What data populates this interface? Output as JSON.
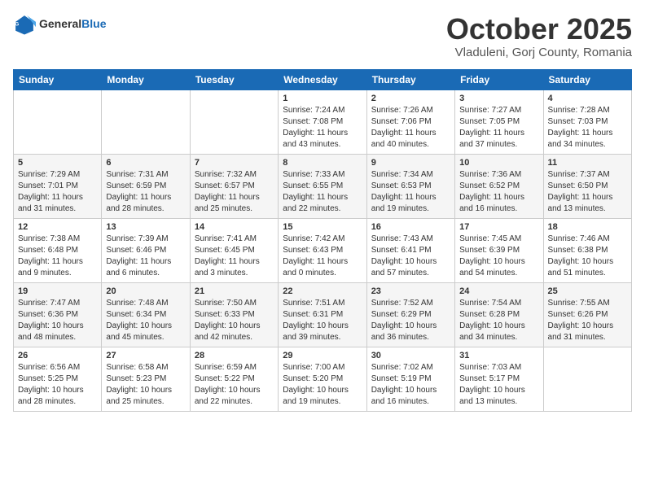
{
  "header": {
    "logo_general": "General",
    "logo_blue": "Blue",
    "month": "October 2025",
    "location": "Vladuleni, Gorj County, Romania"
  },
  "days_of_week": [
    "Sunday",
    "Monday",
    "Tuesday",
    "Wednesday",
    "Thursday",
    "Friday",
    "Saturday"
  ],
  "weeks": [
    [
      {
        "day": "",
        "sunrise": "",
        "sunset": "",
        "daylight": ""
      },
      {
        "day": "",
        "sunrise": "",
        "sunset": "",
        "daylight": ""
      },
      {
        "day": "",
        "sunrise": "",
        "sunset": "",
        "daylight": ""
      },
      {
        "day": "1",
        "sunrise": "Sunrise: 7:24 AM",
        "sunset": "Sunset: 7:08 PM",
        "daylight": "Daylight: 11 hours and 43 minutes."
      },
      {
        "day": "2",
        "sunrise": "Sunrise: 7:26 AM",
        "sunset": "Sunset: 7:06 PM",
        "daylight": "Daylight: 11 hours and 40 minutes."
      },
      {
        "day": "3",
        "sunrise": "Sunrise: 7:27 AM",
        "sunset": "Sunset: 7:05 PM",
        "daylight": "Daylight: 11 hours and 37 minutes."
      },
      {
        "day": "4",
        "sunrise": "Sunrise: 7:28 AM",
        "sunset": "Sunset: 7:03 PM",
        "daylight": "Daylight: 11 hours and 34 minutes."
      }
    ],
    [
      {
        "day": "5",
        "sunrise": "Sunrise: 7:29 AM",
        "sunset": "Sunset: 7:01 PM",
        "daylight": "Daylight: 11 hours and 31 minutes."
      },
      {
        "day": "6",
        "sunrise": "Sunrise: 7:31 AM",
        "sunset": "Sunset: 6:59 PM",
        "daylight": "Daylight: 11 hours and 28 minutes."
      },
      {
        "day": "7",
        "sunrise": "Sunrise: 7:32 AM",
        "sunset": "Sunset: 6:57 PM",
        "daylight": "Daylight: 11 hours and 25 minutes."
      },
      {
        "day": "8",
        "sunrise": "Sunrise: 7:33 AM",
        "sunset": "Sunset: 6:55 PM",
        "daylight": "Daylight: 11 hours and 22 minutes."
      },
      {
        "day": "9",
        "sunrise": "Sunrise: 7:34 AM",
        "sunset": "Sunset: 6:53 PM",
        "daylight": "Daylight: 11 hours and 19 minutes."
      },
      {
        "day": "10",
        "sunrise": "Sunrise: 7:36 AM",
        "sunset": "Sunset: 6:52 PM",
        "daylight": "Daylight: 11 hours and 16 minutes."
      },
      {
        "day": "11",
        "sunrise": "Sunrise: 7:37 AM",
        "sunset": "Sunset: 6:50 PM",
        "daylight": "Daylight: 11 hours and 13 minutes."
      }
    ],
    [
      {
        "day": "12",
        "sunrise": "Sunrise: 7:38 AM",
        "sunset": "Sunset: 6:48 PM",
        "daylight": "Daylight: 11 hours and 9 minutes."
      },
      {
        "day": "13",
        "sunrise": "Sunrise: 7:39 AM",
        "sunset": "Sunset: 6:46 PM",
        "daylight": "Daylight: 11 hours and 6 minutes."
      },
      {
        "day": "14",
        "sunrise": "Sunrise: 7:41 AM",
        "sunset": "Sunset: 6:45 PM",
        "daylight": "Daylight: 11 hours and 3 minutes."
      },
      {
        "day": "15",
        "sunrise": "Sunrise: 7:42 AM",
        "sunset": "Sunset: 6:43 PM",
        "daylight": "Daylight: 11 hours and 0 minutes."
      },
      {
        "day": "16",
        "sunrise": "Sunrise: 7:43 AM",
        "sunset": "Sunset: 6:41 PM",
        "daylight": "Daylight: 10 hours and 57 minutes."
      },
      {
        "day": "17",
        "sunrise": "Sunrise: 7:45 AM",
        "sunset": "Sunset: 6:39 PM",
        "daylight": "Daylight: 10 hours and 54 minutes."
      },
      {
        "day": "18",
        "sunrise": "Sunrise: 7:46 AM",
        "sunset": "Sunset: 6:38 PM",
        "daylight": "Daylight: 10 hours and 51 minutes."
      }
    ],
    [
      {
        "day": "19",
        "sunrise": "Sunrise: 7:47 AM",
        "sunset": "Sunset: 6:36 PM",
        "daylight": "Daylight: 10 hours and 48 minutes."
      },
      {
        "day": "20",
        "sunrise": "Sunrise: 7:48 AM",
        "sunset": "Sunset: 6:34 PM",
        "daylight": "Daylight: 10 hours and 45 minutes."
      },
      {
        "day": "21",
        "sunrise": "Sunrise: 7:50 AM",
        "sunset": "Sunset: 6:33 PM",
        "daylight": "Daylight: 10 hours and 42 minutes."
      },
      {
        "day": "22",
        "sunrise": "Sunrise: 7:51 AM",
        "sunset": "Sunset: 6:31 PM",
        "daylight": "Daylight: 10 hours and 39 minutes."
      },
      {
        "day": "23",
        "sunrise": "Sunrise: 7:52 AM",
        "sunset": "Sunset: 6:29 PM",
        "daylight": "Daylight: 10 hours and 36 minutes."
      },
      {
        "day": "24",
        "sunrise": "Sunrise: 7:54 AM",
        "sunset": "Sunset: 6:28 PM",
        "daylight": "Daylight: 10 hours and 34 minutes."
      },
      {
        "day": "25",
        "sunrise": "Sunrise: 7:55 AM",
        "sunset": "Sunset: 6:26 PM",
        "daylight": "Daylight: 10 hours and 31 minutes."
      }
    ],
    [
      {
        "day": "26",
        "sunrise": "Sunrise: 6:56 AM",
        "sunset": "Sunset: 5:25 PM",
        "daylight": "Daylight: 10 hours and 28 minutes."
      },
      {
        "day": "27",
        "sunrise": "Sunrise: 6:58 AM",
        "sunset": "Sunset: 5:23 PM",
        "daylight": "Daylight: 10 hours and 25 minutes."
      },
      {
        "day": "28",
        "sunrise": "Sunrise: 6:59 AM",
        "sunset": "Sunset: 5:22 PM",
        "daylight": "Daylight: 10 hours and 22 minutes."
      },
      {
        "day": "29",
        "sunrise": "Sunrise: 7:00 AM",
        "sunset": "Sunset: 5:20 PM",
        "daylight": "Daylight: 10 hours and 19 minutes."
      },
      {
        "day": "30",
        "sunrise": "Sunrise: 7:02 AM",
        "sunset": "Sunset: 5:19 PM",
        "daylight": "Daylight: 10 hours and 16 minutes."
      },
      {
        "day": "31",
        "sunrise": "Sunrise: 7:03 AM",
        "sunset": "Sunset: 5:17 PM",
        "daylight": "Daylight: 10 hours and 13 minutes."
      },
      {
        "day": "",
        "sunrise": "",
        "sunset": "",
        "daylight": ""
      }
    ]
  ]
}
